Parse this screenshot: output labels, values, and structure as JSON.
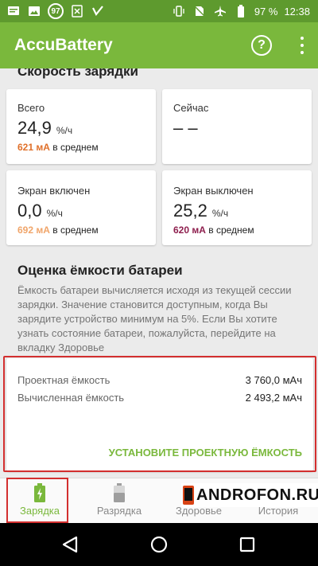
{
  "status_bar": {
    "badge_number": "97",
    "battery_percent": "97 %",
    "time": "12:38"
  },
  "app_bar": {
    "title": "AccuBattery",
    "help_symbol": "?"
  },
  "charge_speed": {
    "section_title": "Скорость зарядки",
    "cards": [
      {
        "label": "Всего",
        "value": "24,9",
        "unit": "%/ч",
        "avg_value": "621 мА",
        "avg_text": "в среднем",
        "avg_color": "#e0702a"
      },
      {
        "label": "Сейчас",
        "value": "– –",
        "unit": "",
        "avg_value": "",
        "avg_text": ""
      },
      {
        "label": "Экран включен",
        "value": "0,0",
        "unit": "%/ч",
        "avg_value": "692 мА",
        "avg_text": "в среднем",
        "avg_color": "#f0a56a"
      },
      {
        "label": "Экран выключен",
        "value": "25,2",
        "unit": "%/ч",
        "avg_value": "620 мА",
        "avg_text": "в среднем",
        "avg_color": "#8e1f4e"
      }
    ]
  },
  "capacity": {
    "title": "Оценка ёмкости батареи",
    "description": "Ёмкость батареи вычисляется исходя из текущей сессии зарядки. Значение становится доступным, когда Вы зарядите устройство минимум на 5%. Если Вы хотите узнать состояние батареи, пожалуйста, перейдите на вкладку Здоровье",
    "design_label": "Проектная ёмкость",
    "design_value": "3 760,0 мАч",
    "estimated_label": "Вычисленная ёмкость",
    "estimated_value": "2 493,2 мАч",
    "set_button": "УСТАНОВИТЕ ПРОЕКТНУЮ ЁМКОСТЬ"
  },
  "bottom_nav": {
    "items": [
      {
        "label": "Зарядка",
        "icon": "battery-charging-icon",
        "active": true
      },
      {
        "label": "Разрядка",
        "icon": "battery-icon",
        "active": false
      },
      {
        "label": "Здоровье",
        "icon": "battery-health-icon",
        "active": false
      },
      {
        "label": "История",
        "icon": "history-icon",
        "active": false
      }
    ]
  },
  "watermark": {
    "text": "ANDROFON.RU"
  },
  "colors": {
    "accent": "#7ab83c",
    "status_bar": "#5e9a2e",
    "highlight": "#d32f2f"
  }
}
